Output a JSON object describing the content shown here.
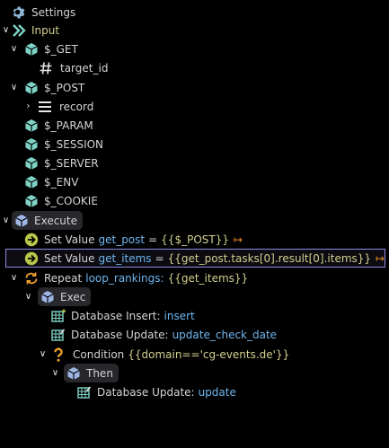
{
  "tree": {
    "settings": {
      "label": "Settings",
      "icon": "gear-icon"
    },
    "input": {
      "label": "Input",
      "icon": "double-chevron-icon"
    },
    "get": {
      "label": "$_GET",
      "icon": "cube-icon"
    },
    "target_id": {
      "label": "target_id",
      "icon": "hash-icon"
    },
    "post": {
      "label": "$_POST",
      "icon": "cube-icon"
    },
    "record": {
      "label": "record",
      "icon": "list-icon"
    },
    "param": {
      "label": "$_PARAM",
      "icon": "cube-icon"
    },
    "session": {
      "label": "$_SESSION",
      "icon": "cube-icon"
    },
    "server": {
      "label": "$_SERVER",
      "icon": "cube-icon"
    },
    "env": {
      "label": "$_ENV",
      "icon": "cube-icon"
    },
    "cookie": {
      "label": "$_COOKIE",
      "icon": "cube-icon"
    },
    "execute": {
      "label": "Execute",
      "icon": "cube-icon"
    },
    "set1": {
      "label": "Set Value",
      "var": "get_post",
      "eq": "=",
      "expr": "{{$_POST}}",
      "icon": "arrow-circle-icon"
    },
    "set2": {
      "label": "Set Value",
      "var": "get_items",
      "eq": "=",
      "expr": "{{get_post.tasks[0].result[0].items}}",
      "icon": "arrow-circle-icon"
    },
    "repeat": {
      "label": "Repeat",
      "var": "loop_rankings:",
      "expr": "{{get_items}}",
      "icon": "repeat-icon"
    },
    "exec": {
      "label": "Exec",
      "icon": "cube-icon"
    },
    "db_insert": {
      "label": "Database Insert:",
      "value": "insert",
      "icon": "db-insert-icon"
    },
    "db_update1": {
      "label": "Database Update:",
      "value": "update_check_date",
      "icon": "db-update-icon"
    },
    "condition": {
      "label": "Condition",
      "expr": "{{domain=='cg-events.de'}}",
      "icon": "question-icon"
    },
    "then": {
      "label": "Then",
      "icon": "cube-icon"
    },
    "db_update2": {
      "label": "Database Update:",
      "value": "update",
      "icon": "db-update-icon"
    }
  },
  "colors": {
    "background": "#000000",
    "text": "#d4d4d4",
    "cube": "#7fd3c6",
    "variable": "#6fb6ef",
    "expression": "#d2cf8e",
    "action": "#f08a2a",
    "selection_border": "#8e8ce6",
    "set_value_icon": "#b9c64a",
    "repeat_icon": "#f0a030"
  }
}
